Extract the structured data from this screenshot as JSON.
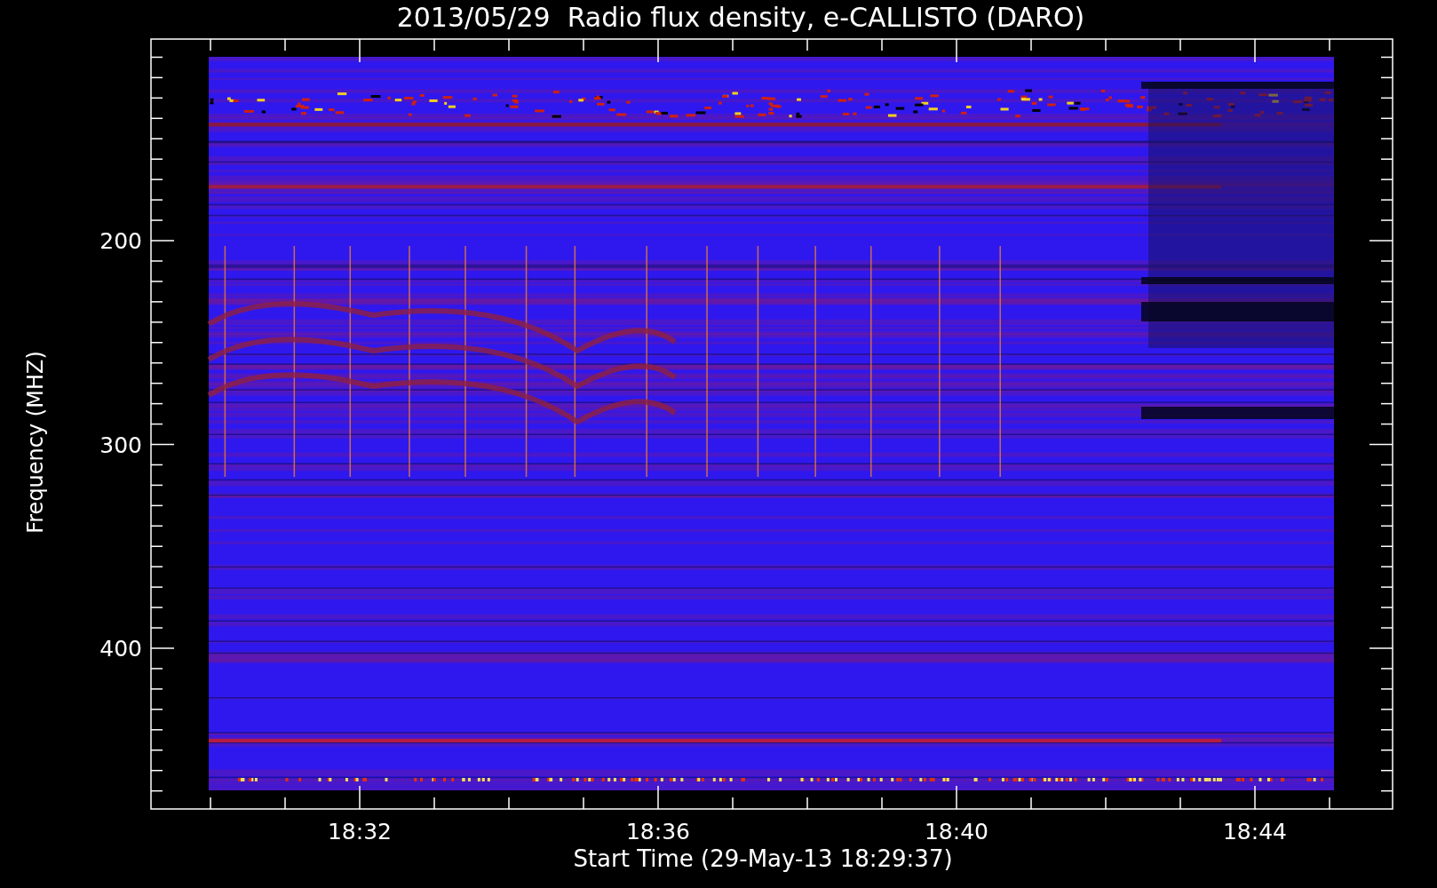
{
  "title": "2013/05/29  Radio flux density, e-CALLISTO (DARO)",
  "y_axis": {
    "label": "Frequency (MHZ)",
    "ticks": [
      "200",
      "300",
      "400"
    ]
  },
  "x_axis": {
    "label": "Start Time (29-May-13 18:29:37)",
    "ticks": [
      "18:32",
      "18:36",
      "18:40",
      "18:44"
    ]
  }
}
